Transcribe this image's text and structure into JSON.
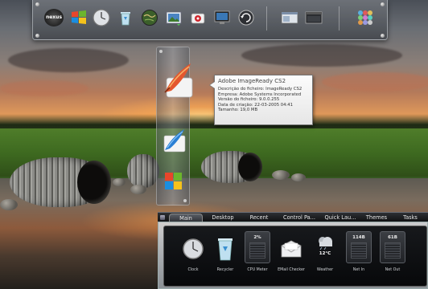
{
  "desktop": {
    "wallpaper": "sunset-over-river-with-culverts"
  },
  "topbar": {
    "items": [
      {
        "name": "nexus-logo",
        "label": "nexus",
        "icon": "nexus-logo-icon"
      },
      {
        "name": "windows-start",
        "icon": "windows-logo-icon"
      },
      {
        "name": "clock",
        "icon": "clock-icon"
      },
      {
        "name": "recycle-bin",
        "icon": "recycle-bin-icon"
      },
      {
        "name": "globe",
        "icon": "globe-icon"
      },
      {
        "name": "pictures",
        "icon": "photos-icon"
      },
      {
        "name": "media",
        "icon": "media-icon"
      },
      {
        "name": "monitor",
        "icon": "monitor-icon"
      },
      {
        "name": "refresh",
        "icon": "refresh-icon"
      },
      {
        "name": "window-1",
        "icon": "window-icon"
      },
      {
        "name": "window-2",
        "icon": "window-icon"
      },
      {
        "name": "apps-grid",
        "icon": "apps-grid-icon"
      }
    ]
  },
  "stack": {
    "items": [
      {
        "name": "adobe-imageready",
        "icon": "feather-icon"
      },
      {
        "name": "adobe-photoshop",
        "icon": "feather-blue-icon"
      },
      {
        "name": "microsoft-office",
        "icon": "office-icon"
      }
    ]
  },
  "tooltip": {
    "title": "Adobe ImageReady CS2",
    "lines": [
      "Descrição do ficheiro: ImageReady CS2",
      "Empresa: Adobe Systems Incorporated",
      "Versão do ficheiro: 9.0.0.255",
      "Data de criação: 22-03-2005 04:41",
      "Tamanho: 19,0 MB"
    ]
  },
  "panel": {
    "tabs": [
      "Main",
      "Desktop",
      "Recent",
      "Control Pa...",
      "Quick Lau...",
      "Themes",
      "Tasks"
    ],
    "active_tab": "Main",
    "gadgets": [
      {
        "label": "Clock",
        "icon": "clock-icon"
      },
      {
        "label": "Recycler",
        "icon": "recycle-bin-icon"
      },
      {
        "label": "CPU Meter",
        "value": "2%",
        "icon": "meter-icon"
      },
      {
        "label": "EMail Checker",
        "icon": "envelope-icon"
      },
      {
        "label": "Weather",
        "value": "12°C",
        "icon": "weather-icon"
      },
      {
        "label": "Net In",
        "value": "114B",
        "icon": "meter-icon"
      },
      {
        "label": "Net Out",
        "value": "61B",
        "icon": "meter-icon"
      }
    ]
  },
  "colors": {
    "tooltip_bg": "#f2f2f2",
    "panel_dark": "#0c0d0f",
    "dock_glass": "#6a6e74"
  }
}
